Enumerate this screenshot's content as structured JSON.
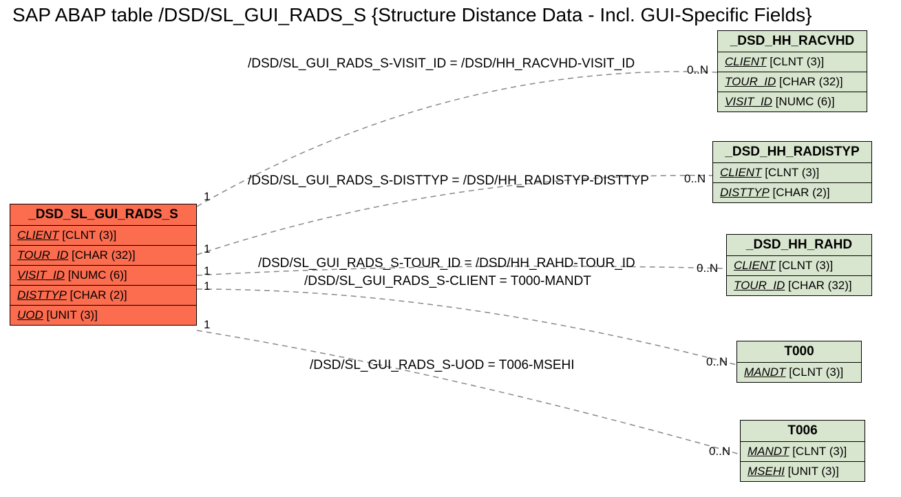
{
  "title": "SAP ABAP table /DSD/SL_GUI_RADS_S {Structure Distance Data - Incl. GUI-Specific Fields}",
  "primary": {
    "name": "_DSD_SL_GUI_RADS_S",
    "fields": [
      {
        "name": "CLIENT",
        "type": "[CLNT (3)]"
      },
      {
        "name": "TOUR_ID",
        "type": "[CHAR (32)]"
      },
      {
        "name": "VISIT_ID",
        "type": "[NUMC (6)]"
      },
      {
        "name": "DISTTYP",
        "type": "[CHAR (2)]"
      },
      {
        "name": "UOD",
        "type": "[UNIT (3)]"
      }
    ]
  },
  "related": [
    {
      "name": "_DSD_HH_RACVHD",
      "fields": [
        {
          "name": "CLIENT",
          "type": "[CLNT (3)]"
        },
        {
          "name": "TOUR_ID",
          "type": "[CHAR (32)]"
        },
        {
          "name": "VISIT_ID",
          "type": "[NUMC (6)]"
        }
      ]
    },
    {
      "name": "_DSD_HH_RADISTYP",
      "fields": [
        {
          "name": "CLIENT",
          "type": "[CLNT (3)]"
        },
        {
          "name": "DISTTYP",
          "type": "[CHAR (2)]"
        }
      ]
    },
    {
      "name": "_DSD_HH_RAHD",
      "fields": [
        {
          "name": "CLIENT",
          "type": "[CLNT (3)]"
        },
        {
          "name": "TOUR_ID",
          "type": "[CHAR (32)]"
        }
      ]
    },
    {
      "name": "T000",
      "fields": [
        {
          "name": "MANDT",
          "type": "[CLNT (3)]"
        }
      ]
    },
    {
      "name": "T006",
      "fields": [
        {
          "name": "MANDT",
          "type": "[CLNT (3)]"
        },
        {
          "name": "MSEHI",
          "type": "[UNIT (3)]"
        }
      ]
    }
  ],
  "relations": [
    {
      "label": "/DSD/SL_GUI_RADS_S-VISIT_ID = /DSD/HH_RACVHD-VISIT_ID",
      "left": "1",
      "right": "0..N"
    },
    {
      "label": "/DSD/SL_GUI_RADS_S-DISTTYP = /DSD/HH_RADISTYP-DISTTYP",
      "left": "1",
      "right": "0..N"
    },
    {
      "label": "/DSD/SL_GUI_RADS_S-TOUR_ID = /DSD/HH_RAHD-TOUR_ID",
      "left": "1",
      "right": "0..N"
    },
    {
      "label": "/DSD/SL_GUI_RADS_S-CLIENT = T000-MANDT",
      "left": "1",
      "right": "0..N"
    },
    {
      "label": "/DSD/SL_GUI_RADS_S-UOD = T006-MSEHI",
      "left": "1",
      "right": "0..N"
    }
  ],
  "chart_data": {
    "type": "er-diagram",
    "primary_entity": "_DSD_SL_GUI_RADS_S",
    "entities": {
      "_DSD_SL_GUI_RADS_S": [
        "CLIENT CLNT(3)",
        "TOUR_ID CHAR(32)",
        "VISIT_ID NUMC(6)",
        "DISTTYP CHAR(2)",
        "UOD UNIT(3)"
      ],
      "_DSD_HH_RACVHD": [
        "CLIENT CLNT(3)",
        "TOUR_ID CHAR(32)",
        "VISIT_ID NUMC(6)"
      ],
      "_DSD_HH_RADISTYP": [
        "CLIENT CLNT(3)",
        "DISTTYP CHAR(2)"
      ],
      "_DSD_HH_RAHD": [
        "CLIENT CLNT(3)",
        "TOUR_ID CHAR(32)"
      ],
      "T000": [
        "MANDT CLNT(3)"
      ],
      "T006": [
        "MANDT CLNT(3)",
        "MSEHI UNIT(3)"
      ]
    },
    "relationships": [
      {
        "from": "_DSD_SL_GUI_RADS_S.VISIT_ID",
        "to": "_DSD_HH_RACVHD.VISIT_ID",
        "card_from": "1",
        "card_to": "0..N"
      },
      {
        "from": "_DSD_SL_GUI_RADS_S.DISTTYP",
        "to": "_DSD_HH_RADISTYP.DISTTYP",
        "card_from": "1",
        "card_to": "0..N"
      },
      {
        "from": "_DSD_SL_GUI_RADS_S.TOUR_ID",
        "to": "_DSD_HH_RAHD.TOUR_ID",
        "card_from": "1",
        "card_to": "0..N"
      },
      {
        "from": "_DSD_SL_GUI_RADS_S.CLIENT",
        "to": "T000.MANDT",
        "card_from": "1",
        "card_to": "0..N"
      },
      {
        "from": "_DSD_SL_GUI_RADS_S.UOD",
        "to": "T006.MSEHI",
        "card_from": "1",
        "card_to": "0..N"
      }
    ]
  }
}
